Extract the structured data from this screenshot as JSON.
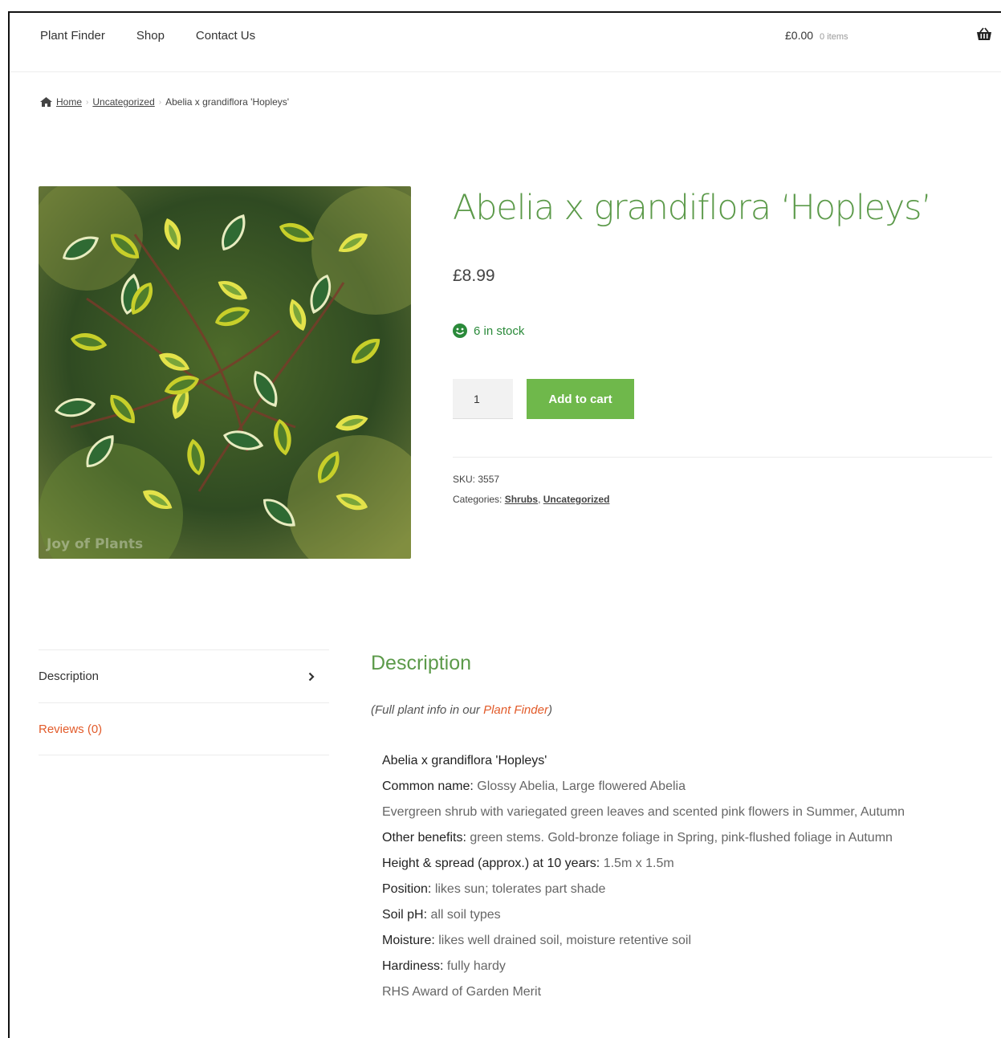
{
  "nav": {
    "items": [
      "Plant Finder",
      "Shop",
      "Contact Us"
    ]
  },
  "cart": {
    "amount": "£0.00",
    "count": "0 items",
    "icon": "basket-icon"
  },
  "breadcrumb": {
    "icon": "home-icon",
    "home": "Home",
    "category": "Uncategorized",
    "current": "Abelia x grandiflora 'Hopleys'"
  },
  "product": {
    "image_watermark": "Joy of Plants",
    "title": "Abelia x grandiflora ‘Hopleys’",
    "price": "£8.99",
    "stock": "6 in stock",
    "quantity": "1",
    "add_to_cart": "Add to cart",
    "sku_label": "SKU:",
    "sku": "3557",
    "categories_label": "Categories:",
    "categories": [
      "Shrubs",
      "Uncategorized"
    ],
    "category_separator": ","
  },
  "tabs": [
    {
      "label": "Description"
    },
    {
      "label": "Reviews (0)"
    }
  ],
  "description": {
    "heading": "Description",
    "intro_prefix": "(Full plant info in our ",
    "intro_link": "Plant Finder",
    "intro_suffix": ")",
    "rows": [
      {
        "label": "",
        "value": "Abelia x grandiflora 'Hopleys'"
      },
      {
        "label": "Common name:",
        "value": " Glossy Abelia, Large flowered Abelia"
      },
      {
        "label": "",
        "value": "Evergreen shrub with variegated green leaves and scented pink flowers in Summer, Autumn"
      },
      {
        "label": "Other benefits:",
        "value": " green stems. Gold-bronze foliage in Spring, pink-flushed foliage in Autumn"
      },
      {
        "label": "Height & spread (approx.) at 10 years:",
        "value": " 1.5m x 1.5m"
      },
      {
        "label": "Position:",
        "value": " likes sun; tolerates part shade"
      },
      {
        "label": "Soil pH:",
        "value": " all soil types"
      },
      {
        "label": "Moisture:",
        "value": " likes well drained soil, moisture retentive soil"
      },
      {
        "label": "Hardiness:",
        "value": " fully hardy"
      },
      {
        "label": "",
        "value": "RHS Award of Garden Merit"
      }
    ]
  },
  "colors": {
    "brand_green": "#5c9a4a",
    "button_green": "#6fb84b",
    "stock_green": "#2a8a3a",
    "link_orange": "#e25b2a"
  }
}
